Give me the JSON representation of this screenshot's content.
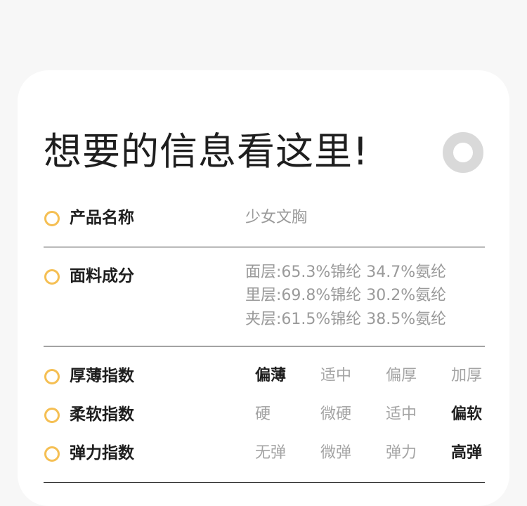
{
  "title": "想要的信息看这里!",
  "rows": {
    "name": {
      "label": "产品名称",
      "value": "少女文胸"
    },
    "fabric": {
      "label": "面料成分",
      "lines": [
        "面层:65.3%锦纶 34.7%氨纶",
        "里层:69.8%锦纶 30.2%氨纶",
        "夹层:61.5%锦纶 38.5%氨纶"
      ]
    },
    "thickness": {
      "label": "厚薄指数",
      "options": [
        "偏薄",
        "适中",
        "偏厚",
        "加厚"
      ],
      "selected": "偏薄"
    },
    "softness": {
      "label": "柔软指数",
      "options": [
        "硬",
        "微硬",
        "适中",
        "偏软"
      ],
      "selected": "偏软"
    },
    "elasticity": {
      "label": "弹力指数",
      "options": [
        "无弹",
        "微弹",
        "弹力",
        "高弹"
      ],
      "selected": "高弹"
    }
  },
  "colors": {
    "bullet": "#f5bf53",
    "ring": "#d9d9d9",
    "text_dark": "#1e1e1e",
    "text_muted": "#9a9a9a"
  }
}
